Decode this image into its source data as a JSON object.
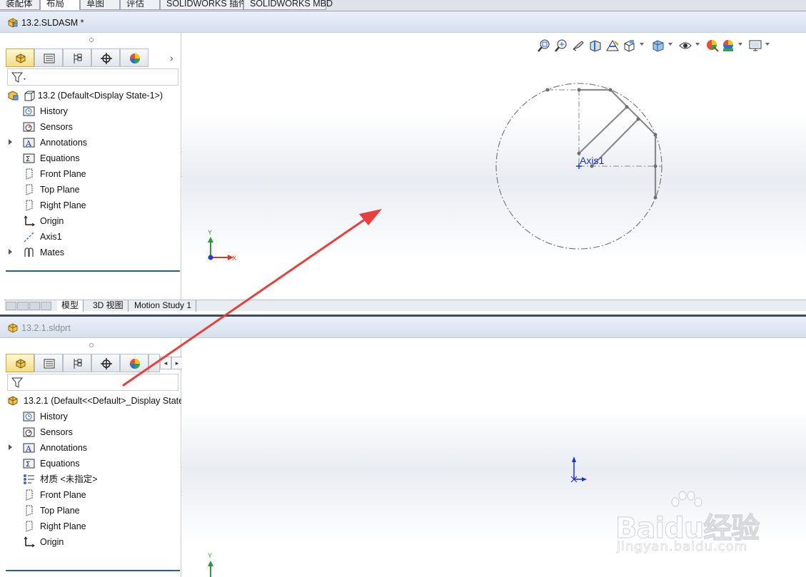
{
  "command_tabs": [
    "装配体",
    "布局",
    "草图",
    "评估",
    "SOLIDWORKS 插件",
    "SOLIDWORKS MBD"
  ],
  "active_command_tab": "布局",
  "top_window": {
    "title": "13.2.SLDASM *",
    "root_label": "13.2  (Default<Display State-1>)",
    "tree": [
      {
        "label": "History",
        "icon": "history-icon",
        "expandable": false
      },
      {
        "label": "Sensors",
        "icon": "sensors-icon",
        "expandable": false
      },
      {
        "label": "Annotations",
        "icon": "annotations-icon",
        "expandable": true
      },
      {
        "label": "Equations",
        "icon": "equations-icon",
        "expandable": false
      },
      {
        "label": "Front Plane",
        "icon": "plane-icon",
        "expandable": false
      },
      {
        "label": "Top Plane",
        "icon": "plane-icon",
        "expandable": false
      },
      {
        "label": "Right Plane",
        "icon": "plane-icon",
        "expandable": false
      },
      {
        "label": "Origin",
        "icon": "origin-icon",
        "expandable": false
      },
      {
        "label": "Axis1",
        "icon": "axis-icon",
        "expandable": false
      },
      {
        "label": "Mates",
        "icon": "mates-icon",
        "expandable": true
      }
    ],
    "model_tabs": [
      "模型",
      "3D 视图",
      "Motion Study 1"
    ],
    "active_model_tab": "模型",
    "axis_label": "Axis1",
    "triad": {
      "y": "Y",
      "x": "X"
    }
  },
  "bottom_window": {
    "title": "13.2.1.sldprt",
    "root_label": "13.2.1  (Default<<Default>_Display State",
    "tree": [
      {
        "label": "History",
        "icon": "history-icon",
        "expandable": false
      },
      {
        "label": "Sensors",
        "icon": "sensors-icon",
        "expandable": false
      },
      {
        "label": "Annotations",
        "icon": "annotations-icon",
        "expandable": true
      },
      {
        "label": "Equations",
        "icon": "equations-icon",
        "expandable": false
      },
      {
        "label": "材质 <未指定>",
        "icon": "material-icon",
        "expandable": false
      },
      {
        "label": "Front Plane",
        "icon": "plane-icon",
        "expandable": false
      },
      {
        "label": "Top Plane",
        "icon": "plane-icon",
        "expandable": false
      },
      {
        "label": "Right Plane",
        "icon": "plane-icon",
        "expandable": false
      },
      {
        "label": "Origin",
        "icon": "origin-icon",
        "expandable": false
      }
    ],
    "triad": {
      "y": "Y"
    }
  },
  "heads_up_toolbar": [
    "zoom-to-fit-icon",
    "zoom-to-area-icon",
    "previous-view-icon",
    "section-view-icon",
    "dynamic-annotation-icon",
    "view-orientation-icon",
    "display-style-icon",
    "hide-show-items-icon",
    "edit-appearance-icon",
    "apply-scene-icon",
    "view-settings-icon"
  ],
  "watermark": {
    "brand": "Baidu经验",
    "url": "jingyan.baidu.com"
  },
  "colors": {
    "annotation_arrow": "#e8403c",
    "selection_line": "#1f5fa8",
    "axis_blue": "#1a2fd8"
  }
}
